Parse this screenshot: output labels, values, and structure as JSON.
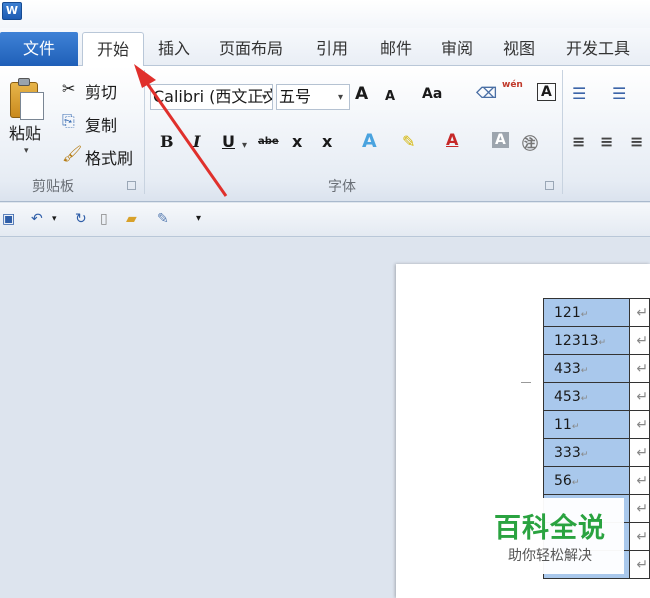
{
  "app": {
    "icon_glyph": "W"
  },
  "tabs": {
    "file": "文件",
    "items": [
      "开始",
      "插入",
      "页面布局",
      "引用",
      "邮件",
      "审阅",
      "视图",
      "开发工具"
    ],
    "active": "开始"
  },
  "clipboard": {
    "paste": "粘贴",
    "cut": "剪切",
    "copy": "复制",
    "format_painter": "格式刷",
    "group_label": "剪贴板"
  },
  "font": {
    "family": "Calibri (西文正文)",
    "size": "五号",
    "grow": "A",
    "shrink": "A",
    "change_case": "Aa",
    "bold": "B",
    "italic": "I",
    "underline": "U",
    "strikethrough": "abe",
    "subscript": "x",
    "superscript": "x",
    "phonetic": "wén",
    "group_label": "字体"
  },
  "document": {
    "rows": [
      "121",
      "12313",
      "433",
      "453",
      "11",
      "333",
      "56",
      "",
      "",
      ""
    ]
  },
  "watermark": {
    "title": "百科全说",
    "subtitle": "助你轻松解决"
  },
  "colors": {
    "file_tab": "#2a6cc8",
    "annotation_arrow": "#e0302c",
    "table_highlight": "#a9c8ec",
    "watermark_green": "#2aa340"
  }
}
